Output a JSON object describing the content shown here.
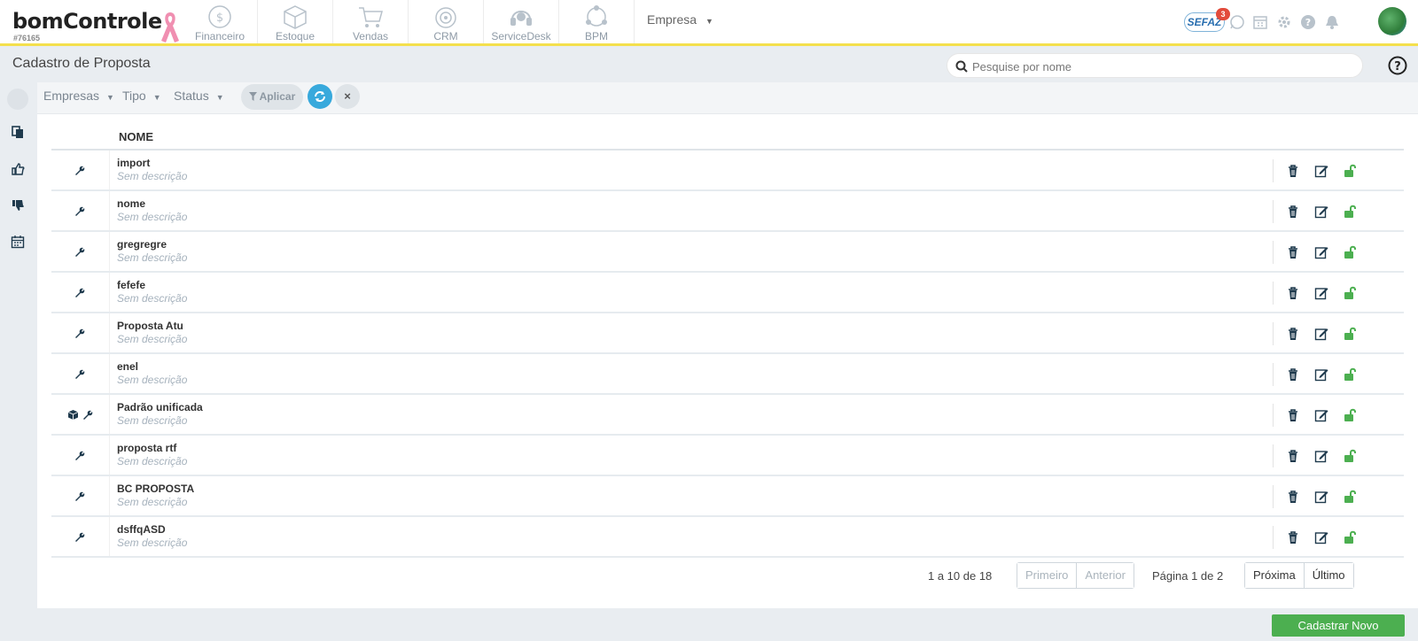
{
  "brand": {
    "logo_text": "bomControle",
    "account_id": "#76165",
    "ribbon_color": "#f08fb1"
  },
  "modules": [
    {
      "label": "Financeiro",
      "icon": "dollar-coin-icon"
    },
    {
      "label": "Estoque",
      "icon": "box-icon"
    },
    {
      "label": "Vendas",
      "icon": "shopping-cart-icon"
    },
    {
      "label": "CRM",
      "icon": "target-icon"
    },
    {
      "label": "ServiceDesk",
      "icon": "headset-icon"
    },
    {
      "label": "BPM",
      "icon": "network-icon"
    }
  ],
  "empresa_menu": {
    "label": "Empresa"
  },
  "top_right": {
    "sefaz_label": "SEFAZ",
    "sefaz_badge": "3"
  },
  "page": {
    "title": "Cadastro de Proposta",
    "search_placeholder": "Pesquise por nome"
  },
  "filters": {
    "empresas": "Empresas",
    "tipo": "Tipo",
    "status": "Status",
    "aplicar": "Aplicar",
    "clear": "×"
  },
  "table": {
    "column_nome": "NOME",
    "rows": [
      {
        "name": "import",
        "desc": "Sem descrição",
        "has_box": false
      },
      {
        "name": "nome",
        "desc": "Sem descrição",
        "has_box": false
      },
      {
        "name": "gregregre",
        "desc": "Sem descrição",
        "has_box": false
      },
      {
        "name": "fefefe",
        "desc": "Sem descrição",
        "has_box": false
      },
      {
        "name": "Proposta Atu",
        "desc": "Sem descrição",
        "has_box": false
      },
      {
        "name": "enel",
        "desc": "Sem descrição",
        "has_box": false
      },
      {
        "name": "Padrão unificada",
        "desc": "Sem descrição",
        "has_box": true
      },
      {
        "name": "proposta rtf",
        "desc": "Sem descrição",
        "has_box": false
      },
      {
        "name": "BC PROPOSTA",
        "desc": "Sem descrição",
        "has_box": false
      },
      {
        "name": "dsffqASD",
        "desc": "Sem descrição",
        "has_box": false
      }
    ]
  },
  "pagination": {
    "info": "1 a 10 de 18",
    "first": "Primeiro",
    "previous": "Anterior",
    "page_label": "Página 1 de 2",
    "next": "Próxima",
    "last": "Último"
  },
  "actions": {
    "new_button": "Cadastrar Novo"
  },
  "colors": {
    "accent_yellow": "#f4e04d",
    "primary_blue": "#38a9dc",
    "success_green": "#4caf50",
    "icon_dark": "#1f3a4d"
  }
}
